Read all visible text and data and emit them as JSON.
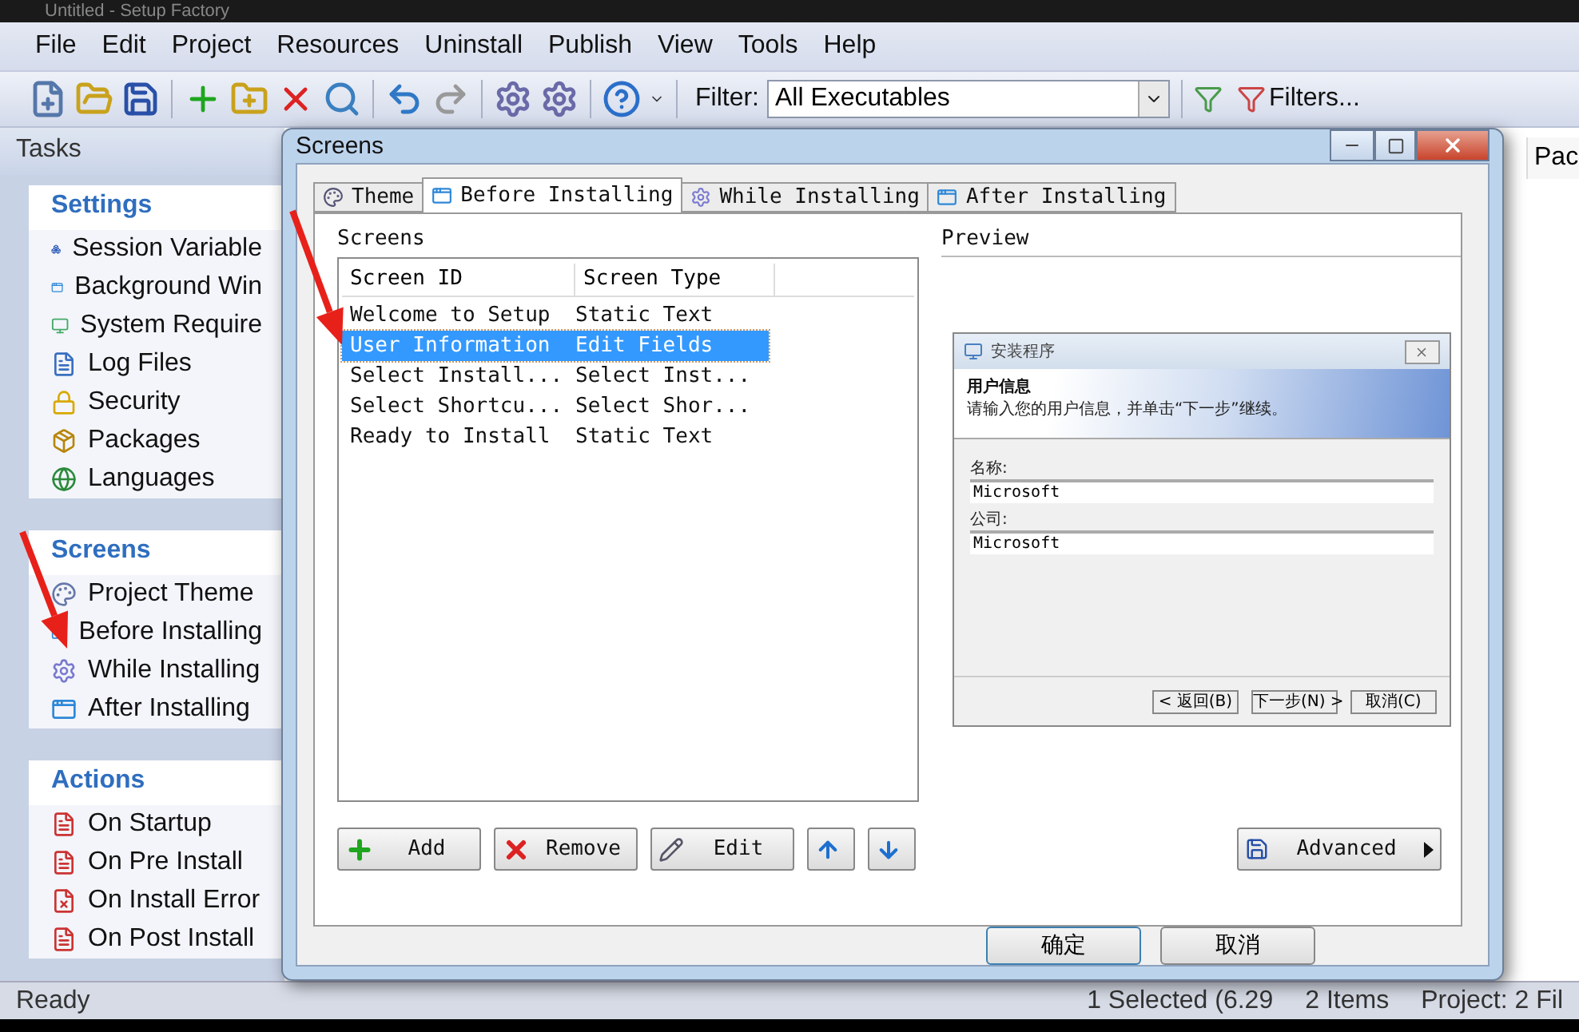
{
  "app_title": "Untitled - Setup Factory",
  "menu": [
    "File",
    "Edit",
    "Project",
    "Resources",
    "Uninstall",
    "Publish",
    "View",
    "Tools",
    "Help"
  ],
  "toolbar": {
    "filter_label": "Filter:",
    "filter_value": "All Executables",
    "filters_button": "Filters..."
  },
  "tasks": {
    "title": "Tasks",
    "groups": [
      {
        "title": "Settings",
        "items": [
          "Session Variable",
          "Background Win",
          "System Require",
          "Log Files",
          "Security",
          "Packages",
          "Languages"
        ]
      },
      {
        "title": "Screens",
        "items": [
          "Project Theme",
          "Before Installing",
          "While Installing",
          "After Installing"
        ]
      },
      {
        "title": "Actions",
        "items": [
          "On Startup",
          "On Pre Install",
          "On Install Error",
          "On Post Install"
        ]
      }
    ]
  },
  "file_list": {
    "column_heading": "Pac"
  },
  "status_bar": [
    "Ready",
    "1 Selected (6.29",
    "2 Items",
    "Project: 2 Fil"
  ],
  "dialog": {
    "title": "Screens",
    "tabs": [
      {
        "label": "Theme",
        "selected": false
      },
      {
        "label": "Before Installing",
        "selected": true
      },
      {
        "label": "While Installing",
        "selected": false
      },
      {
        "label": "After Installing",
        "selected": false
      }
    ],
    "screens_label": "Screens",
    "columns": [
      "Screen ID",
      "Screen Type"
    ],
    "rows": [
      {
        "id": "Welcome to Setup",
        "type": "Static Text",
        "selected": false
      },
      {
        "id": "User Information",
        "type": "Edit Fields",
        "selected": true
      },
      {
        "id": "Select Install...",
        "type": "Select Inst...",
        "selected": false
      },
      {
        "id": "Select Shortcu...",
        "type": "Select Shor...",
        "selected": false
      },
      {
        "id": "Ready to Install",
        "type": "Static Text",
        "selected": false
      }
    ],
    "preview_label": "Preview",
    "preview": {
      "title": "安装程序",
      "heading": "用户信息",
      "subheading": "请输入您的用户信息，并单击“下一步”继续。",
      "fields": [
        {
          "label": "名称:",
          "value": "Microsoft"
        },
        {
          "label": "公司:",
          "value": "Microsoft"
        }
      ],
      "buttons": [
        "< 返回(B)",
        "下一步(N) >",
        "取消(C)"
      ]
    },
    "buttons": [
      {
        "kind": "add",
        "label": "Add"
      },
      {
        "kind": "remove",
        "label": "Remove"
      },
      {
        "kind": "edit",
        "label": "Edit"
      },
      {
        "kind": "up"
      },
      {
        "kind": "down"
      }
    ],
    "advanced": "Advanced",
    "ok": "确定",
    "cancel": "取消"
  }
}
